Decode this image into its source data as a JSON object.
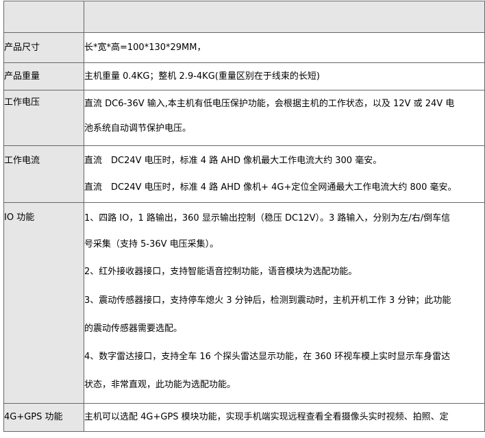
{
  "rows": {
    "size": {
      "label": "产品尺寸",
      "value": "长*宽*高=100*130*29MM，"
    },
    "weight": {
      "label": "产品重量",
      "value": "主机重量 0.4KG；整机 2.9-4KG(重量区别在于线束的长短)"
    },
    "voltage": {
      "label": "工作电压",
      "lines": [
        "直流 DC6-36V 输入,本主机有低电压保护功能，会根据主机的工作状态，以及 12V 或 24V 电",
        "池系统自动调节保护电压。"
      ]
    },
    "current": {
      "label": "工作电流",
      "lines": [
        "直流　DC24V 电压时，标准 4 路 AHD 像机最大工作电流大约 300 毫安。",
        "直流　DC24V 电压时，标准 4 路 AHD 像机+ 4G+定位全网通最大工作电流大约 800 毫安。"
      ]
    },
    "io": {
      "label": "IO 功能",
      "items": [
        [
          "1、四路 IO，1 路输出，360 显示输出控制（稳压 DC12V）。3 路输入，分别为左/右/倒车信",
          "号采集（支持 5-36V 电压采集）。"
        ],
        [
          "2、红外接收器接口，支持智能语音控制功能，语音模块为选配功能。"
        ],
        [
          "3、震动传感器接口，支持停车熄火 3 分钟后，检测到震动时，主机开机工作 3 分钟；此功能",
          "的震动传感器需要选配。"
        ],
        [
          "4、数字雷达接口，支持全车 16 个探头雷达显示功能，在 360 环视车模上实时显示车身雷达",
          "状态，非常直观，此功能为选配功能。"
        ]
      ]
    },
    "gps": {
      "label": "4G+GPS 功能",
      "value": "主机可以选配 4G+GPS 模块功能，实现手机端实现远程查看全看摄像头实时视频、拍照、定"
    }
  }
}
